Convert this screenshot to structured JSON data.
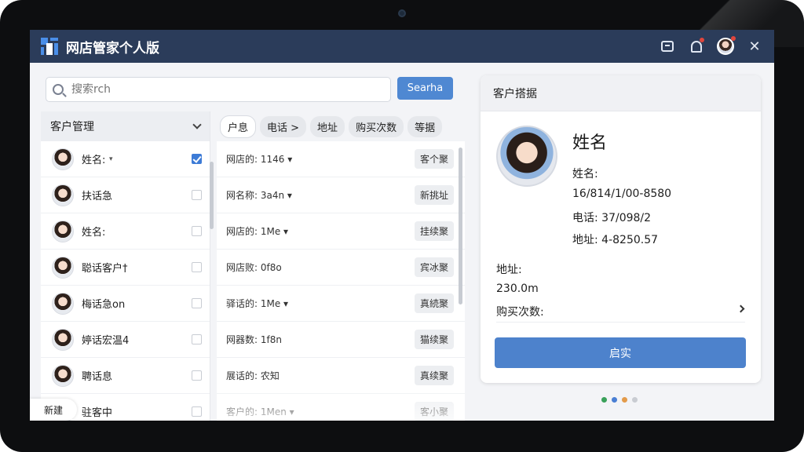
{
  "app": {
    "title": "网店管家个人版"
  },
  "titlebar": {
    "icons": [
      "message-icon",
      "notification-bell-icon",
      "user-avatar-icon",
      "close-icon"
    ]
  },
  "search": {
    "placeholder": "搜索rch",
    "button_label": "Searha"
  },
  "customer_list": {
    "header": "客户管理",
    "items": [
      {
        "name": "姓名:",
        "caret": "▾",
        "checked": true
      },
      {
        "name": "扶话急",
        "checked": false
      },
      {
        "name": "姓名:",
        "checked": false
      },
      {
        "name": "聪话客户†",
        "checked": false
      },
      {
        "name": "梅话急on",
        "checked": false
      },
      {
        "name": "婷话宏温4",
        "checked": false
      },
      {
        "name": "聘话息",
        "checked": false
      },
      {
        "name": "驻客中",
        "checked": false
      }
    ],
    "new_button": "新建"
  },
  "records": {
    "tabs": [
      "户息",
      "电话 >",
      "地址",
      "购买次数",
      "等据"
    ],
    "rows": [
      {
        "text": "网店的: 1146 ▾",
        "action": "客个聚"
      },
      {
        "text": "网名称: 3a4n ▾",
        "action": "新挑址"
      },
      {
        "text": "网店的: 1Me ▾",
        "action": "挂续聚"
      },
      {
        "text": "网店败: 0f8o",
        "action": "宾冰聚"
      },
      {
        "text": "驿话的: 1Me ▾",
        "action": "真続聚"
      },
      {
        "text": "网器数: 1f8n",
        "action": "猫续聚"
      },
      {
        "text": "展话的: 农知",
        "action": "真续聚"
      },
      {
        "text": "客户的: 1Men ▾",
        "action": "客小聚"
      }
    ]
  },
  "detail": {
    "header": "客户搭据",
    "title": "姓名",
    "name_label": "姓名:",
    "id_value": "16/814/1/00-8580",
    "phone": "电话: 37/098/2",
    "address": "地址: 4-8250.57",
    "address2_label": "地址:",
    "amount": "230.0m",
    "purchases_label": "购买次数:",
    "confirm_button": "启实"
  },
  "pager": {
    "dot_colors": [
      "#3aa15a",
      "#4a7fd4",
      "#e39b4b",
      "#c9ccd2"
    ]
  },
  "colors": {
    "titlebar": "#2b3c5a",
    "accent": "#4f88d2",
    "checkbox_on": "#3d7bd6"
  }
}
